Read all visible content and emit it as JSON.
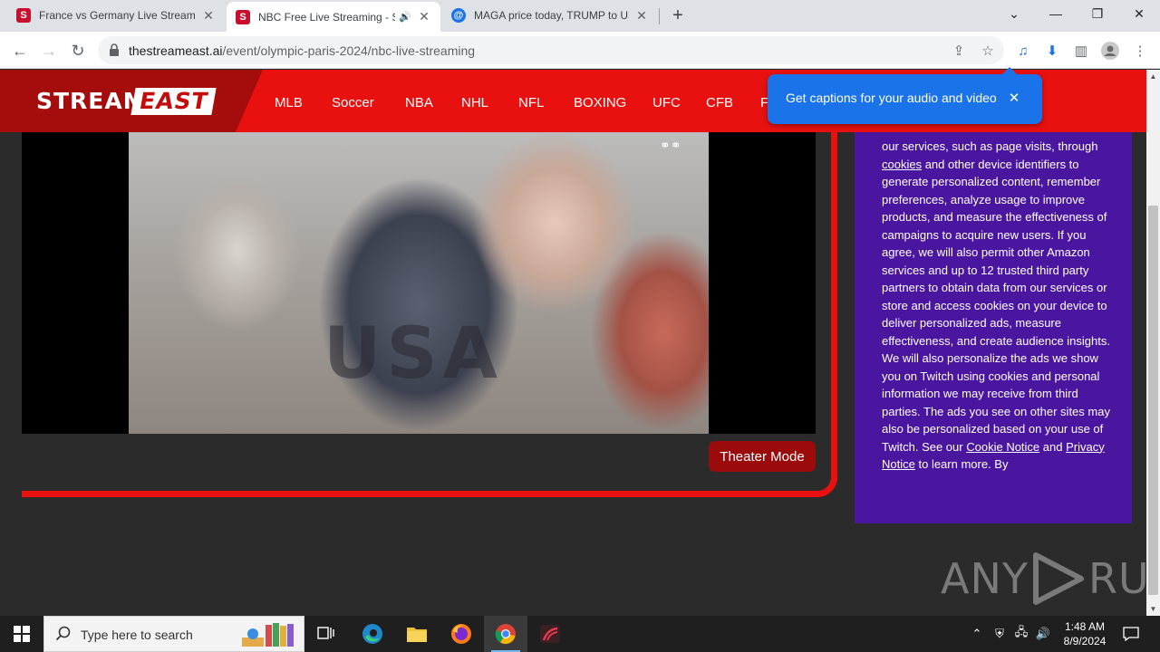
{
  "browser": {
    "tabs": [
      {
        "title": "France vs Germany Live Streamin",
        "favicon": "S",
        "favicon_color": "#c8102e"
      },
      {
        "title": "NBC Free Live Streaming - S",
        "favicon": "S",
        "favicon_color": "#c8102e",
        "active": true
      },
      {
        "title": "MAGA price today, TRUMP to US",
        "favicon": "@",
        "favicon_color": "#1a73e8"
      }
    ],
    "url_domain": "thestreameast.ai",
    "url_path": "/event/olympic-paris-2024/nbc-live-streaming"
  },
  "site": {
    "logo_left": "STREAM",
    "logo_right": "EAST",
    "nav": [
      "MLB",
      "Soccer",
      "NBA",
      "NHL",
      "NFL",
      "BOXING",
      "UFC",
      "CFB",
      "F"
    ],
    "theater_mode": "Theater Mode",
    "video_overlay": "USA",
    "consent_text": {
      "p1": "our services, such as page visits, through",
      "link_cookies": "cookies",
      "p2": "and other device identifiers to generate personalized content, remember preferences, analyze usage to improve products, and measure the effectiveness of campaigns to acquire new users. If you agree, we will also permit other Amazon services and up to 12 trusted third party partners to obtain data from our services or store and access cookies on your device to deliver personalized ads, measure effectiveness, and create audience insights. We will also personalize the ads we show you on Twitch using cookies and personal information we may receive from third parties. The ads you see on other sites may also be personalized based on your use of Twitch. See our",
      "link_cookie_notice": "Cookie Notice",
      "p3": "and",
      "link_privacy": "Privacy Notice",
      "p4": "to learn more. By"
    }
  },
  "captions_popup": {
    "text": "Get captions for your audio and video"
  },
  "watermark": {
    "left": "ANY",
    "right": "RUN"
  },
  "taskbar": {
    "search_placeholder": "Type here to search",
    "time": "1:48 AM",
    "date": "8/9/2024"
  },
  "colors": {
    "site_red": "#e8110f",
    "consent_purple": "#4a16a0",
    "caption_blue": "#1a73e8"
  }
}
